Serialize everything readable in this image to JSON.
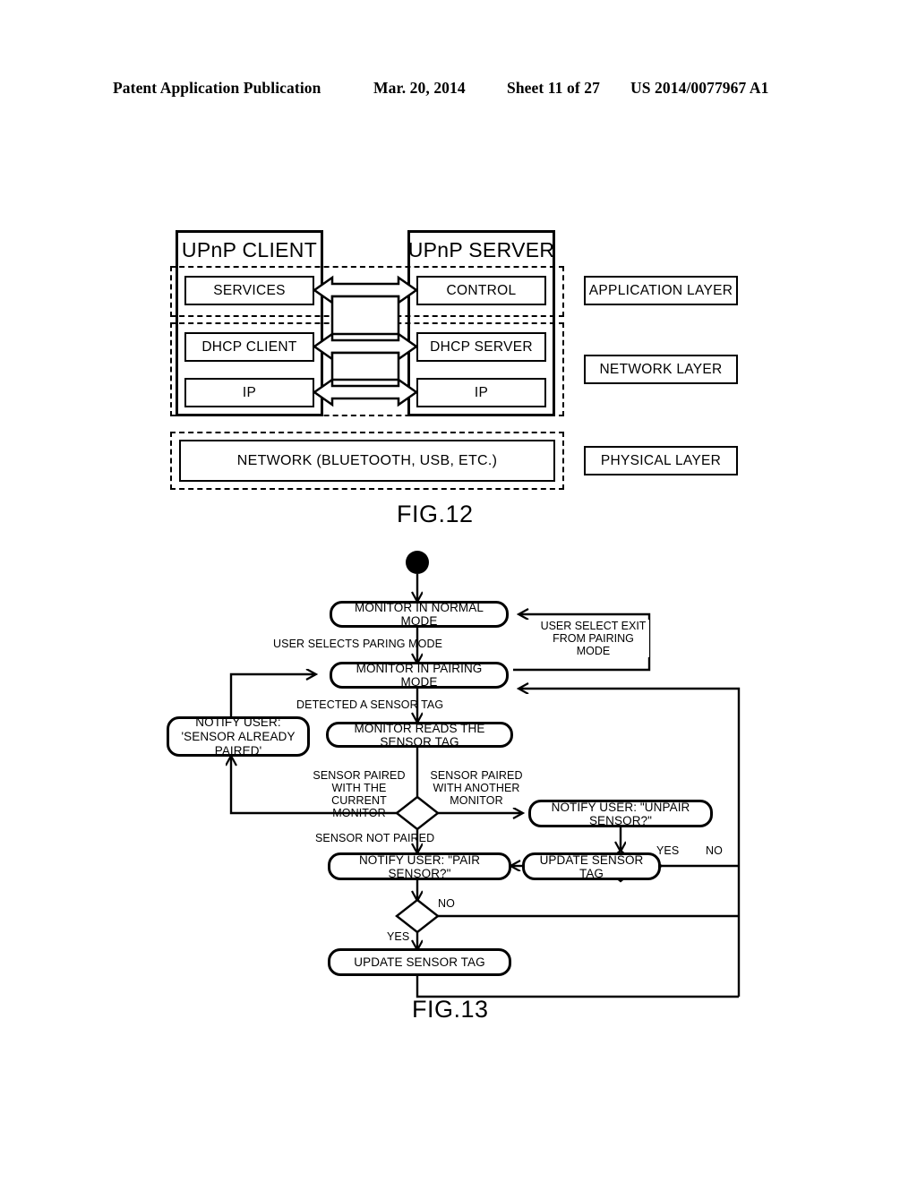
{
  "header": {
    "publication": "Patent Application Publication",
    "date": "Mar. 20, 2014",
    "sheet": "Sheet 11 of 27",
    "docnum": "US 2014/0077967 A1"
  },
  "fig12": {
    "caption": "FIG.12",
    "client_title": "UPnP CLIENT",
    "server_title": "UPnP SERVER",
    "boxes": {
      "services": "SERVICES",
      "control": "CONTROL",
      "dhcp_client": "DHCP CLIENT",
      "dhcp_server": "DHCP SERVER",
      "ip_client": "IP",
      "ip_server": "IP",
      "network": "NETWORK (BLUETOOTH, USB, ETC.)"
    },
    "layers": {
      "application": "APPLICATION LAYER",
      "network": "NETWORK LAYER",
      "physical": "PHYSICAL LAYER"
    }
  },
  "fig13": {
    "caption": "FIG.13",
    "states": {
      "normal_mode": "MONITOR IN NORMAL MODE",
      "pairing_mode": "MONITOR IN PAIRING MODE",
      "reads_tag": "MONITOR READS THE SENSOR TAG",
      "already_paired": "NOTIFY USER: 'SENSOR ALREADY PAIRED'",
      "unpair_sensor": "NOTIFY USER: \"UNPAIR SENSOR?\"",
      "pair_sensor": "NOTIFY USER: \"PAIR SENSOR?\"",
      "update_tag_mid": "UPDATE SENSOR TAG",
      "update_tag_bottom": "UPDATE SENSOR TAG"
    },
    "labels": {
      "selects_pairing": "USER SELECTS PARING MODE",
      "exit_pairing": "USER SELECT EXIT FROM PAIRING MODE",
      "detected_tag": "DETECTED A SENSOR TAG",
      "paired_current": "SENSOR PAIRED WITH THE CURRENT MONITOR",
      "paired_another": "SENSOR PAIRED WITH ANOTHER MONITOR",
      "not_paired": "SENSOR NOT PAIRED",
      "yes_upper": "YES",
      "no_upper": "NO",
      "yes_lower": "YES",
      "no_lower": "NO"
    }
  },
  "colors": {
    "ink": "#000000",
    "paper": "#ffffff"
  }
}
